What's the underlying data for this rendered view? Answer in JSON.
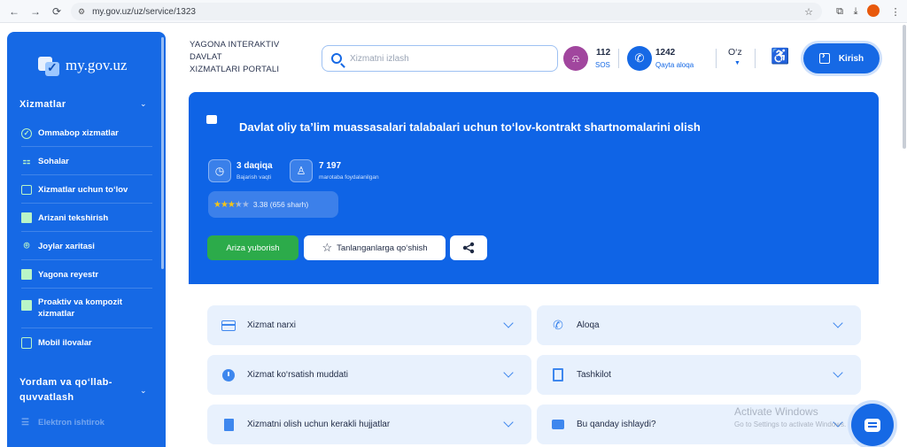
{
  "browser": {
    "url": "my.gov.uz/uz/service/1323",
    "back_icon": "←",
    "forward_icon": "→",
    "reload_icon": "⟳",
    "tune_icon": "⚙",
    "star_icon": "☆",
    "puzzle_icon": "⧉",
    "download_icon": "⤓",
    "profile_initial": "",
    "menu_icon": "⋮"
  },
  "sidebar": {
    "logo_text": "my.gov.uz",
    "section_services": "Xizmatlar",
    "items": [
      {
        "label": "Ommabop xizmatlar",
        "icon": "check-circle-icon"
      },
      {
        "label": "Sohalar",
        "icon": "grid-icon"
      },
      {
        "label": "Xizmatlar uchun to‘lov",
        "icon": "payment-card-icon"
      },
      {
        "label": "Arizani tekshirish",
        "icon": "document-icon"
      },
      {
        "label": "Joylar xaritasi",
        "icon": "map-pin-icon"
      },
      {
        "label": "Yagona reyestr",
        "icon": "registry-icon"
      },
      {
        "label_line1": "Proaktiv va kompozit",
        "label_line2": "xizmatlar",
        "icon": "proactive-icon"
      },
      {
        "label": "Mobil ilovalar",
        "icon": "mobile-icon"
      }
    ],
    "section_help_line1": "Yordam va qo‘llab-",
    "section_help_line2": "quvvatlash",
    "muted_item": "Elektron ishtirok"
  },
  "header": {
    "portal_title_line1": "YAGONA INTERAKTIV",
    "portal_title_line2": "DAVLAT",
    "portal_title_line3": "XIZMATLARI PORTALI",
    "search_placeholder": "Xizmatni izlash",
    "sos_number": "112",
    "sos_label": "SOS",
    "callback_number": "1242",
    "callback_label": "Qayta aloqa",
    "language": "O‘z",
    "login_label": "Kirish"
  },
  "service": {
    "title": "Davlat oliy ta’lim muassasalari talabalari uchun to‘lov-kontrakt shartnomalarini olish",
    "duration_value": "3 daqiqa",
    "duration_label": "Bajarish vaqti",
    "usage_value": "7 197",
    "usage_label": "marotaba foydalanilgan",
    "rating_value": 3.38,
    "rating_text": "3.38 (656 sharh)",
    "apply_label": "Ariza yuborish",
    "favorite_label": "Tanlanganlarga qo‘shish"
  },
  "accordions": [
    {
      "label": "Xizmat narxi",
      "icon": "payment-card-icon"
    },
    {
      "label": "Aloqa",
      "icon": "phone-icon"
    },
    {
      "label": "Xizmat ko‘rsatish muddati",
      "icon": "clock-icon"
    },
    {
      "label": "Tashkilot",
      "icon": "building-icon"
    },
    {
      "label": "Xizmatni olish uchun kerakli hujjatlar",
      "icon": "document-icon"
    },
    {
      "label": "Bu qanday ishlaydi?",
      "icon": "chat-icon"
    }
  ],
  "overlay": {
    "watermark_title": "Activate Windows",
    "watermark_sub": "Go to Settings to activate Windows."
  },
  "colors": {
    "brand_blue": "#1669e5",
    "hero_blue": "#0f64e6",
    "apply_green": "#2cab4a",
    "sos_purple": "#a1469e",
    "accordion_bg": "#e8f1fd"
  }
}
